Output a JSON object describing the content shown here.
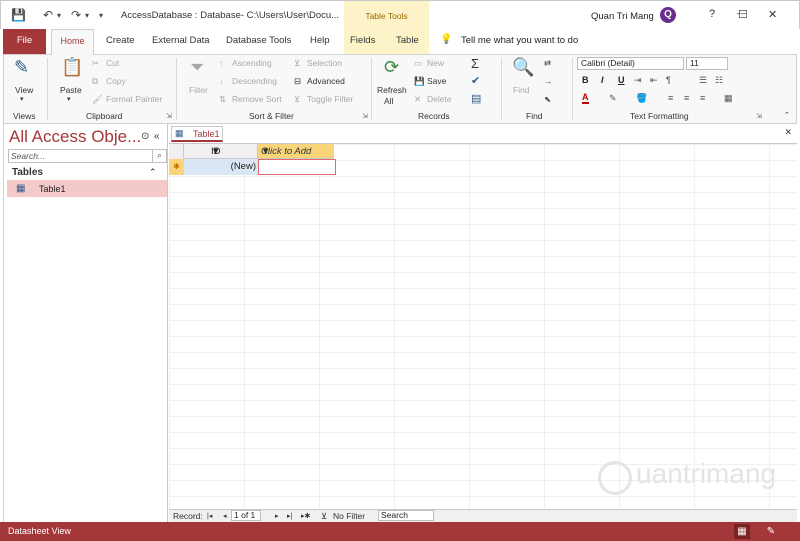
{
  "window": {
    "title": "AccessDatabase : Database- C:\\Users\\User\\Docu...",
    "contextual_tab_group": "Table Tools",
    "user_name": "Quan Tri Mang",
    "user_avatar_letter": "Q",
    "help_glyph": "?",
    "minimize_glyph": "—",
    "maximize_glyph": "☐",
    "close_glyph": "✕",
    "qat": {
      "save": "💾",
      "undo": "↶",
      "undo_drop": "▾",
      "redo": "↷",
      "redo_drop": "▾",
      "customize": "▾"
    }
  },
  "ribbon_tabs": [
    "File",
    "Home",
    "Create",
    "External Data",
    "Database Tools",
    "Help",
    "Fields",
    "Table"
  ],
  "tell_me": {
    "icon": "💡",
    "text": "Tell me what you want to do"
  },
  "ribbon": {
    "views": {
      "view_label": "View",
      "group": "Views"
    },
    "clipboard": {
      "paste": "Paste",
      "cut": "Cut",
      "copy": "Copy",
      "format_painter": "Format Painter",
      "group": "Clipboard"
    },
    "sort_filter": {
      "filter": "Filter",
      "ascending": "Ascending",
      "descending": "Descending",
      "remove_sort": "Remove Sort",
      "selection": "Selection",
      "advanced": "Advanced",
      "toggle_filter": "Toggle Filter",
      "group": "Sort & Filter"
    },
    "records": {
      "refresh": "Refresh",
      "refresh_all": "All",
      "new": "New",
      "save": "Save",
      "delete": "Delete",
      "group": "Records"
    },
    "find": {
      "find": "Find",
      "group": "Find"
    },
    "text_formatting": {
      "font_name": "Calibri (Detail)",
      "font_size": "11",
      "bold": "B",
      "italic": "I",
      "underline": "U",
      "font_color": "A",
      "group": "Text Formatting"
    }
  },
  "nav_pane": {
    "title": "All Access Obje...",
    "search_placeholder": "Search...",
    "section": "Tables",
    "items": [
      {
        "label": "Table1"
      }
    ]
  },
  "document": {
    "tab_label": "Table1",
    "columns": [
      "ID",
      "Click to Add"
    ],
    "new_row_id": "(New)",
    "new_row_marker": "✱"
  },
  "record_nav": {
    "label": "Record:",
    "position": "1 of 1",
    "filter_label": "No Filter",
    "search_placeholder": "Search",
    "first": "|◂",
    "prev": "◂",
    "next": "▸",
    "last": "▸|",
    "new": "▸✱"
  },
  "status": {
    "text": "Datasheet View"
  },
  "watermark": "uantrimang",
  "colors": {
    "access_red": "#a4373a",
    "click_to_add": "#f9d57a",
    "selected_item": "#f4c9c9"
  }
}
